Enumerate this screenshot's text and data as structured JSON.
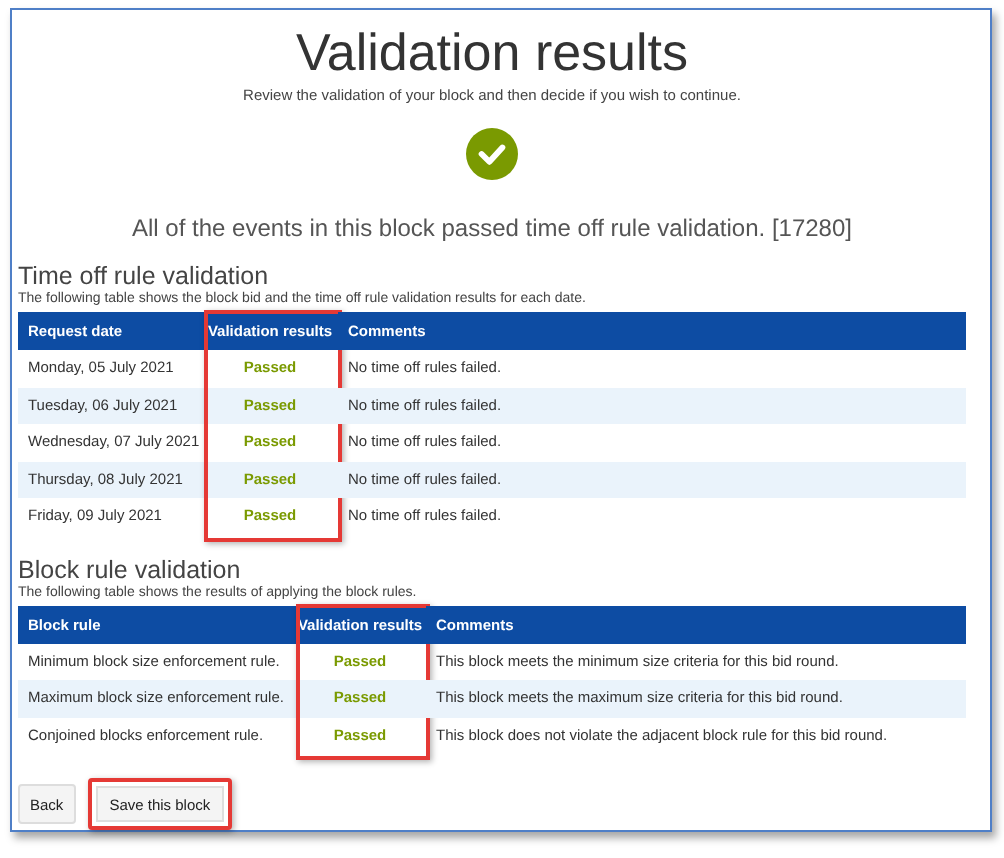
{
  "title": "Validation results",
  "subtitle": "Review the validation of your block and then decide if you wish to continue.",
  "status": {
    "kind": "success",
    "message": "All of the events in this block passed time off rule validation. [17280]"
  },
  "sections": [
    {
      "heading": "Time off rule validation",
      "description": "The following table shows the block bid and the time off rule validation results for each date.",
      "columns": [
        {
          "label": "Request date",
          "highlighted": false
        },
        {
          "label": "Validation results",
          "highlighted": true
        },
        {
          "label": "Comments",
          "highlighted": false
        }
      ],
      "rows": [
        {
          "cells": [
            "Monday, 05 July 2021",
            "Passed",
            "No time off rules failed."
          ],
          "passed": true
        },
        {
          "cells": [
            "Tuesday, 06 July 2021",
            "Passed",
            "No time off rules failed."
          ],
          "passed": true
        },
        {
          "cells": [
            "Wednesday, 07 July 2021",
            "Passed",
            "No time off rules failed."
          ],
          "passed": true
        },
        {
          "cells": [
            "Thursday, 08 July 2021",
            "Passed",
            "No time off rules failed."
          ],
          "passed": true
        },
        {
          "cells": [
            "Friday, 09 July 2021",
            "Passed",
            "No time off rules failed."
          ],
          "passed": true
        }
      ]
    },
    {
      "heading": "Block rule validation",
      "description": "The following table shows the results of applying the block rules.",
      "columns": [
        {
          "label": "Block rule",
          "highlighted": false
        },
        {
          "label": "Validation results",
          "highlighted": true
        },
        {
          "label": "Comments",
          "highlighted": false
        }
      ],
      "rows": [
        {
          "cells": [
            "Minimum block size enforcement rule.",
            "Passed",
            "This block meets the minimum size criteria for this bid round."
          ],
          "passed": true
        },
        {
          "cells": [
            "Maximum block size enforcement rule.",
            "Passed",
            "This block meets the maximum size criteria for this bid round."
          ],
          "passed": true
        },
        {
          "cells": [
            "Conjoined blocks enforcement rule.",
            "Passed",
            "This block does not violate the adjacent block rule for this bid round."
          ],
          "passed": true
        }
      ]
    }
  ],
  "buttons": [
    {
      "label": "Back",
      "highlighted": false
    },
    {
      "label": "Save this block",
      "highlighted": true
    }
  ]
}
